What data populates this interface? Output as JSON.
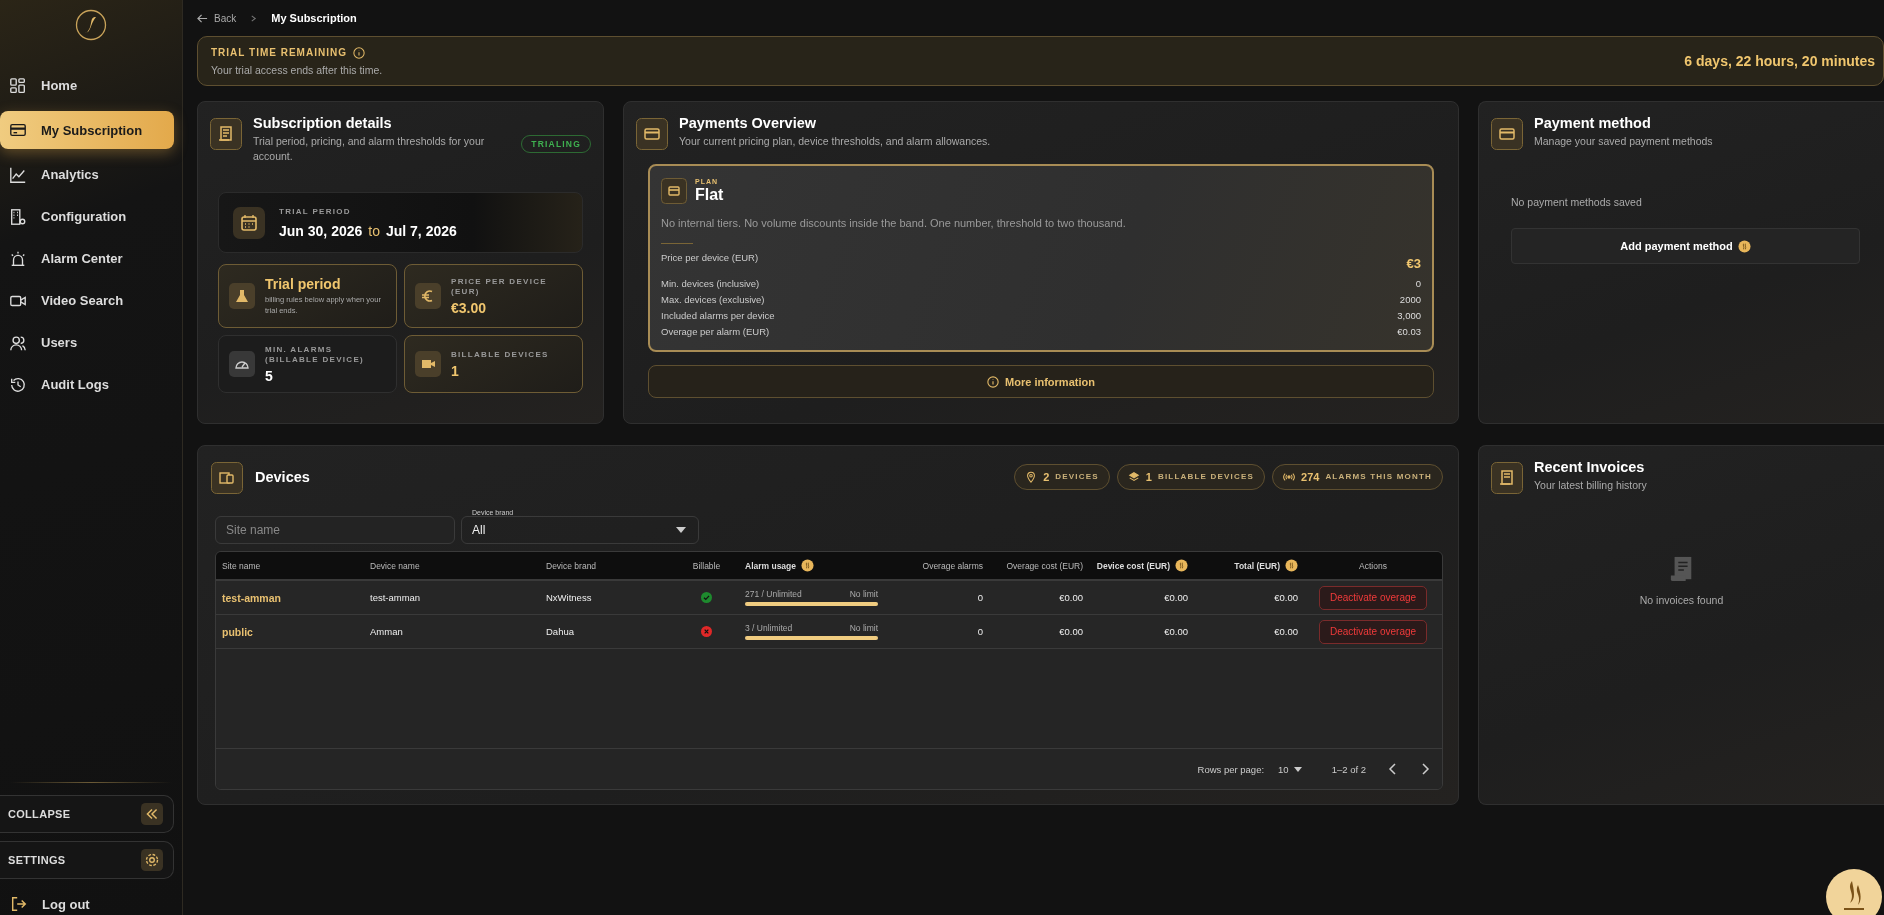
{
  "sidebar": {
    "items": [
      {
        "label": "Home",
        "selected": false
      },
      {
        "label": "My Subscription",
        "selected": true
      },
      {
        "label": "Analytics",
        "selected": false
      },
      {
        "label": "Configuration",
        "selected": false
      },
      {
        "label": "Alarm Center",
        "selected": false
      },
      {
        "label": "Video Search",
        "selected": false
      },
      {
        "label": "Users",
        "selected": false
      },
      {
        "label": "Audit Logs",
        "selected": false
      }
    ],
    "collapse": "COLLAPSE",
    "settings": "SETTINGS",
    "logout": "Log out"
  },
  "breadcrumb": {
    "back": "Back",
    "current": "My Subscription"
  },
  "trial_banner": {
    "title": "TRIAL TIME REMAINING",
    "subtitle": "Your trial access ends after this time.",
    "remaining": "6 days, 22 hours, 20 minutes"
  },
  "subscription": {
    "title": "Subscription details",
    "subtitle": "Trial period, pricing, and alarm thresholds for your account.",
    "status": "TRIALING",
    "period": {
      "label": "TRIAL PERIOD",
      "start": "Jun 30, 2026",
      "separator": "to",
      "end": "Jul 7, 2026"
    },
    "tiles": [
      {
        "kind": "trial",
        "highlighted": true,
        "title": "Trial period",
        "note": "billing rules below apply when your trial ends."
      },
      {
        "kind": "price",
        "highlighted": true,
        "label": "PRICE PER DEVICE (EUR)",
        "value": "€3.00"
      },
      {
        "kind": "alarms",
        "highlighted": false,
        "label": "MIN. ALARMS (BILLABLE DEVICE)",
        "value": "5"
      },
      {
        "kind": "devices",
        "highlighted": true,
        "label": "BILLABLE DEVICES",
        "value": "1"
      }
    ]
  },
  "payments_overview": {
    "title": "Payments Overview",
    "subtitle": "Your current pricing plan, device thresholds, and alarm allowances.",
    "plan": {
      "label": "PLAN",
      "name": "Flat",
      "description": "No internal tiers. No volume discounts inside the band. One number, threshold to two thousand.",
      "rows": [
        {
          "label": "Price per device (EUR)",
          "value": "€3",
          "emphasis": true
        },
        {
          "label": "Min. devices (inclusive)",
          "value": "0",
          "emphasis": false
        },
        {
          "label": "Max. devices (exclusive)",
          "value": "2000",
          "emphasis": false
        },
        {
          "label": "Included alarms per device",
          "value": "3,000",
          "emphasis": false
        },
        {
          "label": "Overage per alarm (EUR)",
          "value": "€0.03",
          "emphasis": false
        }
      ]
    },
    "more_button": "More information"
  },
  "payment_method": {
    "title": "Payment method",
    "subtitle": "Manage your saved payment methods",
    "empty": "No payment methods saved",
    "add_button": "Add payment method"
  },
  "devices": {
    "title": "Devices",
    "badges": [
      {
        "count": "2",
        "label": "DEVICES"
      },
      {
        "count": "1",
        "label": "BILLABLE DEVICES"
      },
      {
        "count": "274",
        "label": "ALARMS THIS MONTH"
      }
    ],
    "filters": {
      "site": {
        "placeholder": "Site name"
      },
      "brand": {
        "label": "Device brand",
        "value": "All"
      }
    },
    "table": {
      "columns": [
        {
          "label": "Site name",
          "info": false
        },
        {
          "label": "Device name",
          "info": false
        },
        {
          "label": "Device brand",
          "info": false
        },
        {
          "label": "Billable",
          "info": false
        },
        {
          "label": "Alarm usage",
          "info": true
        },
        {
          "label": "Overage alarms",
          "info": false
        },
        {
          "label": "Overage cost (EUR)",
          "info": false
        },
        {
          "label": "Device cost (EUR)",
          "info": true
        },
        {
          "label": "Total (EUR)",
          "info": true
        },
        {
          "label": "Actions",
          "info": false
        }
      ],
      "rows": [
        {
          "site": "test-amman",
          "device": "test-amman",
          "brand": "NxWitness",
          "billable": true,
          "usage": "271 / Unlimited",
          "limit": "No limit",
          "level": 1,
          "overage_alarms": "0",
          "overage_cost": "€0.00",
          "device_cost": "€0.00",
          "total": "€0.00",
          "action": "Deactivate overage"
        },
        {
          "site": "public",
          "device": "Amman",
          "brand": "Dahua",
          "billable": false,
          "usage": "3 / Unlimited",
          "limit": "No limit",
          "level": 1,
          "overage_alarms": "0",
          "overage_cost": "€0.00",
          "device_cost": "€0.00",
          "total": "€0.00",
          "action": "Deactivate overage"
        }
      ]
    },
    "pagination": {
      "rows_per_page_label": "Rows per page:",
      "rows_per_page": "10",
      "range": "1–2 of 2"
    }
  },
  "recent_invoices": {
    "title": "Recent Invoices",
    "subtitle": "Your latest billing history",
    "empty": "No invoices found"
  }
}
